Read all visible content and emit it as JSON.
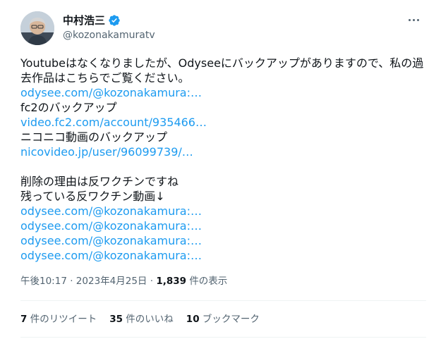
{
  "author": {
    "display_name": "中村浩三",
    "handle": "@kozonakamuratv",
    "verified_icon": "verified-badge-icon",
    "avatar": "avatar"
  },
  "tweet": {
    "text_line1": "Youtubeはなくなりましたが、Odyseeにバックアップがありますので、私の過去作品はこちらでご覧ください。",
    "link1": "odysee.com/@kozonakamura:…",
    "label_fc2": "fc2のバックアップ",
    "link_fc2": "video.fc2.com/account/935466…",
    "label_niconico": "ニコニコ動画のバックアップ",
    "link_niconico": "nicovideo.jp/user/96099739/…",
    "line_reason": "削除の理由は反ワクチンですね",
    "line_remaining": "残っている反ワクチン動画↓",
    "links_remaining": [
      "odysee.com/@kozonakamura:…",
      "odysee.com/@kozonakamura:…",
      "odysee.com/@kozonakamura:…",
      "odysee.com/@kozonakamura:…"
    ]
  },
  "meta": {
    "time": "午後10:17",
    "separator": "·",
    "date": "2023年4月25日",
    "views_count": "1,839",
    "views_label": "件の表示"
  },
  "stats": {
    "retweets_count": "7",
    "retweets_label": "件のリツイート",
    "likes_count": "35",
    "likes_label": "件のいいね",
    "bookmarks_count": "10",
    "bookmarks_label": "ブックマーク"
  },
  "colors": {
    "link": "#1d9bf0",
    "muted": "#536471",
    "text": "#0f1419"
  }
}
